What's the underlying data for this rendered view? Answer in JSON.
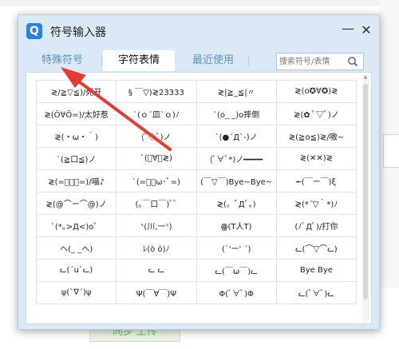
{
  "background": {
    "button_label": "同步 上传"
  },
  "dialog": {
    "icon_letter": "Q",
    "title": "符号输入器",
    "minimize": "—",
    "close": "✕",
    "tabs": [
      {
        "label": "特殊符号",
        "active": false
      },
      {
        "label": "字符表情",
        "active": true
      },
      {
        "label": "最近使用",
        "active": false
      }
    ],
    "search": {
      "placeholder": "搜索符号/表情",
      "icon": "search-icon"
    },
    "grid": [
      [
        "≷/≧▽≦)/死开",
        "§ ￣▽)≷23333",
        "≷|≧_≦|〃",
        "≷(o✪∀✪)≷"
      ],
      [
        "≷(Ö∀Ö=)/太好惹",
        "ˋ(ｏ´皿`ｏ)ﾉ",
        "ˋ(o_ _)o摔倒",
        "≷(✿ ﾟ▽ﾟ)ノ"
      ],
      [
        "≷(・ω・｀)",
        "(ﾟ◇ﾟ)ノ",
        "ˋ(●´Д`-)ノ",
        "≷(≧o≦)≷/嗷~"
      ],
      [
        "ˋ(≧口≦)ノ",
        "ˋ(ﾟ∀ﾟ≷)",
        "(ﾟ∀ﾟ*)ノ━━━━",
        "≷(✕✕)≷"
      ],
      [
        "≷(=ﾟ･ﾟ=)/喵♪",
        "ˋ(=ﾟ･ω･ﾟ=)",
        "(￣▽￣)Bye~Bye~",
        "╾(￣ー￣)ξ"
      ],
      [
        "≷(@⌒ー⌒@)ノ",
        "(｡￣口￣)ﾟﾟ",
        "≷(。ﾟДﾟ。)",
        "≷(*´▽｀*)ﾉ"
      ],
      [
        "ˋ(*｡>Д<)o゜",
        "ᐠ(川,一ᐠ)",
        "ꙮ(T人T)",
        "(ﾉﾟДﾟ)/打你"
      ],
      [
        "へ(_ _へ)",
        "ﾚ(ò ὀ)ﾉ",
        "(ˋ'ー' ˊ)",
        "ᓚ(⌒▽⌒ᓚ)"
      ],
      [
        "ᓚ(ˊuˋᓚ)",
        "ᓚ ᓚ",
        "ᓚ(￣ω￣)ᓚ",
        "Bye Bye"
      ],
      [
        "ψ(ˋ∇ˊ)ψ",
        "Ψ(￣∀￣)Ψ",
        "Φ(ﾟ∀ﾟ)Φ",
        "ᓚ(ﾟ∀ﾟ)ᓚ"
      ]
    ]
  },
  "annotation": {
    "arrow_color": "#e53b32"
  }
}
